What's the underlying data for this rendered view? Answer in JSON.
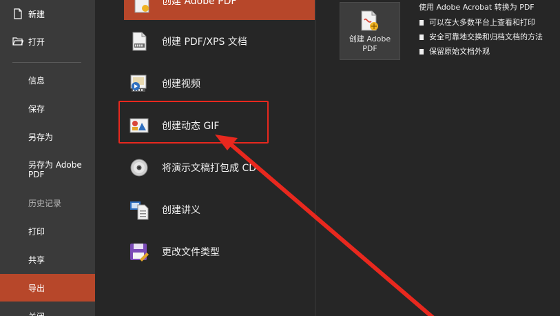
{
  "nav": {
    "new": "新建",
    "open": "打开",
    "info": "信息",
    "save": "保存",
    "save_as": "另存为",
    "save_as_pdf_line1": "另存为 Adobe",
    "save_as_pdf_line2": "PDF",
    "history": "历史记录",
    "print": "打印",
    "share": "共享",
    "export": "导出",
    "close": "关闭"
  },
  "export_options": {
    "adobe_pdf": "创建 Adobe PDF",
    "pdf_xps": "创建 PDF/XPS 文档",
    "video": "创建视频",
    "gif": "创建动态 GIF",
    "package_cd": "将演示文稿打包成 CD",
    "handouts": "创建讲义",
    "change_type": "更改文件类型"
  },
  "right_panel": {
    "button_line1": "创建 Adobe",
    "button_line2": "PDF",
    "title": "使用 Adobe Acrobat 转换为 PDF",
    "bullets": [
      "可以在大多数平台上查看和打印",
      "安全可靠地交换和归档文档的方法",
      "保留原始文档外观"
    ]
  },
  "colors": {
    "accent": "#b7472a",
    "annotation": "#e8281e",
    "nav_bg": "#3a3a3a",
    "main_bg": "#262626"
  },
  "icons": {
    "new": "new-document-icon",
    "open": "open-folder-icon",
    "adobe_pdf": "adobe-pdf-icon",
    "pdf_xps": "pdf-xps-document-icon",
    "video": "video-icon",
    "gif": "animated-gif-icon",
    "package_cd": "cd-disc-icon",
    "handouts": "handouts-icon",
    "change_type": "save-as-type-icon"
  }
}
